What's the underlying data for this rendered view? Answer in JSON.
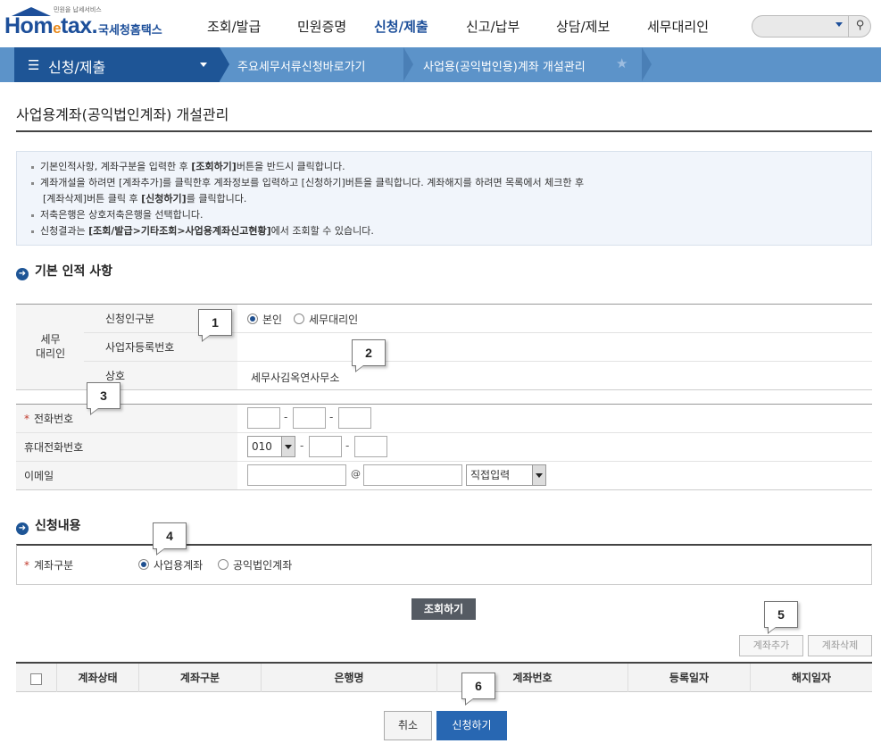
{
  "header": {
    "logo_tagline": "민원을 납세서비스",
    "logo_word_a": "Hom",
    "logo_word_e": "e",
    "logo_word_b": "tax.",
    "logo_kr": "국세청홈택스",
    "menu": [
      "조회/발급",
      "민원증명",
      "신청/제출",
      "신고/납부",
      "상담/제보",
      "세무대리인"
    ],
    "search_icon_glyph": "⚲"
  },
  "navbar": {
    "menu_label": "신청/제출",
    "crumb1": "주요세무서류신청바로가기",
    "crumb2": "사업용(공익법인용)계좌 개설관리"
  },
  "page": {
    "title": "사업용계좌(공익법인계좌) 개설관리"
  },
  "info": {
    "line1_a": "기본인적사항, 계좌구분을 입력한 후 ",
    "line1_b": "[조회하기]",
    "line1_c": "버튼을 반드시 클릭합니다.",
    "line2": "계좌개설을 하려면 [계좌추가]를 클릭한후 계좌정보를 입력하고 [신청하기]버튼을 클릭합니다. 계좌해지를 하려면 목록에서 체크한 후",
    "line3_a": "[계좌삭제]버튼 클릭 후 ",
    "line3_b": "[신청하기]",
    "line3_c": "를 클릭합니다.",
    "line4": "저축은행은 상호저축은행을 선택합니다.",
    "line5_a": "신청결과는 ",
    "line5_b": "[조회/발급>기타조회>사업용계좌신고현황]",
    "line5_c": "에서 조회할 수 있습니다."
  },
  "section1": {
    "title": "기본 인적 사항",
    "group_label": "세무\n대리인",
    "applicant_type_label": "신청인구분",
    "applicant_self": "본인",
    "applicant_agent": "세무대리인",
    "applicant_selected": "본인",
    "bizno_label": "사업자등록번호",
    "bizno_value": "",
    "company_label": "상호",
    "company_value": "세무사김옥연사무소",
    "phone_label": "전화번호",
    "phone_values": [
      "",
      "",
      ""
    ],
    "mobile_label": "휴대전화번호",
    "mobile_prefix": "010",
    "mobile_values": [
      "",
      ""
    ],
    "email_label": "이메일",
    "email_at": "@",
    "email_domain_select": "직접입력"
  },
  "section2": {
    "title": "신청내용",
    "account_type_label": "계좌구분",
    "opt_business": "사업용계좌",
    "opt_public": "공익법인계좌",
    "selected": "사업용계좌",
    "search_button": "조회하기",
    "add_button": "계좌추가",
    "delete_button": "계좌삭제"
  },
  "table": {
    "columns": [
      "계좌상태",
      "계좌구분",
      "은행명",
      "계좌번호",
      "등록일자",
      "해지일자"
    ]
  },
  "footer": {
    "cancel_button": "취소",
    "apply_button": "신청하기"
  },
  "callouts": [
    "1",
    "2",
    "3",
    "4",
    "5",
    "6"
  ],
  "colors": {
    "brand_blue": "#1d4f9a",
    "nav_dark": "#1e5596",
    "nav_light": "#5c93c9",
    "apply_blue": "#2867b2",
    "required_red": "#c0392b"
  }
}
